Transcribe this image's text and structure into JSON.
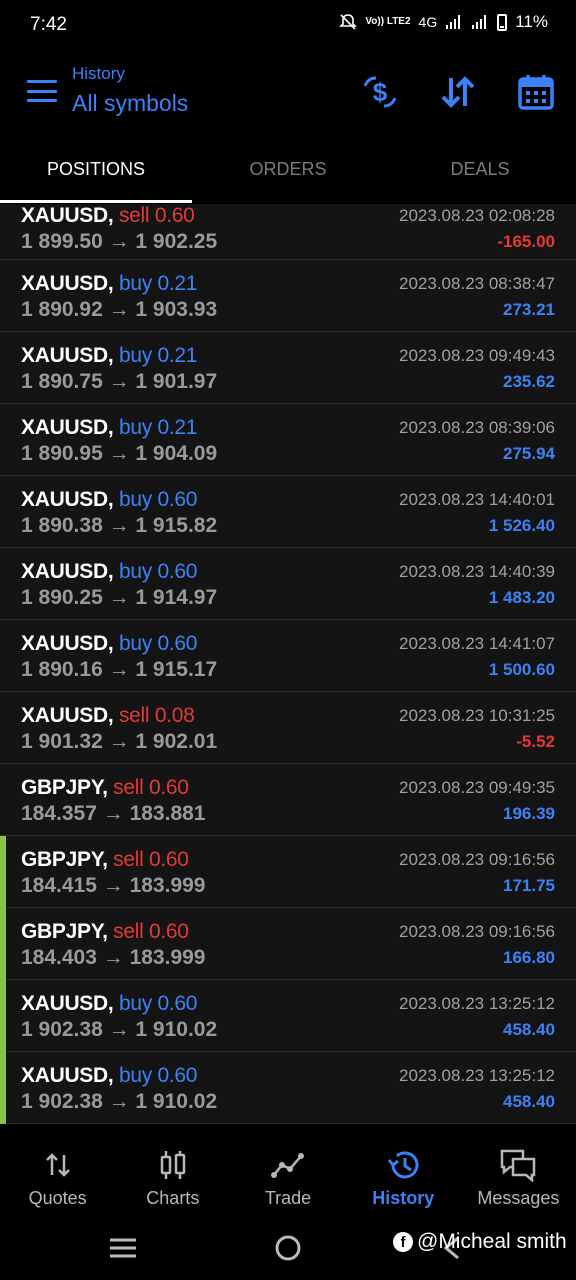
{
  "status": {
    "time": "7:42",
    "network": "4G",
    "volte": "Vo)) LTE2",
    "battery": "11%"
  },
  "header": {
    "title_small": "History",
    "title_large": "All symbols"
  },
  "tabs": [
    "POSITIONS",
    "ORDERS",
    "DEALS"
  ],
  "rows": [
    {
      "symbol": "XAUUSD,",
      "side": "sell 0.60",
      "side_type": "sell",
      "prices": "1 899.50 → 1 902.25",
      "date": "2023.08.23 02:08:28",
      "profit": "-165.00",
      "profit_type": "neg",
      "marked": false
    },
    {
      "symbol": "XAUUSD,",
      "side": "buy 0.21",
      "side_type": "buy",
      "prices": "1 890.92 → 1 903.93",
      "date": "2023.08.23 08:38:47",
      "profit": "273.21",
      "profit_type": "pos",
      "marked": false
    },
    {
      "symbol": "XAUUSD,",
      "side": "buy 0.21",
      "side_type": "buy",
      "prices": "1 890.75 → 1 901.97",
      "date": "2023.08.23 09:49:43",
      "profit": "235.62",
      "profit_type": "pos",
      "marked": false
    },
    {
      "symbol": "XAUUSD,",
      "side": "buy 0.21",
      "side_type": "buy",
      "prices": "1 890.95 → 1 904.09",
      "date": "2023.08.23 08:39:06",
      "profit": "275.94",
      "profit_type": "pos",
      "marked": false
    },
    {
      "symbol": "XAUUSD,",
      "side": "buy 0.60",
      "side_type": "buy",
      "prices": "1 890.38 → 1 915.82",
      "date": "2023.08.23 14:40:01",
      "profit": "1 526.40",
      "profit_type": "pos",
      "marked": false
    },
    {
      "symbol": "XAUUSD,",
      "side": "buy 0.60",
      "side_type": "buy",
      "prices": "1 890.25 → 1 914.97",
      "date": "2023.08.23 14:40:39",
      "profit": "1 483.20",
      "profit_type": "pos",
      "marked": false
    },
    {
      "symbol": "XAUUSD,",
      "side": "buy 0.60",
      "side_type": "buy",
      "prices": "1 890.16 → 1 915.17",
      "date": "2023.08.23 14:41:07",
      "profit": "1 500.60",
      "profit_type": "pos",
      "marked": false
    },
    {
      "symbol": "XAUUSD,",
      "side": "sell 0.08",
      "side_type": "sell",
      "prices": "1 901.32 → 1 902.01",
      "date": "2023.08.23 10:31:25",
      "profit": "-5.52",
      "profit_type": "neg",
      "marked": false
    },
    {
      "symbol": "GBPJPY,",
      "side": "sell 0.60",
      "side_type": "sell",
      "prices": "184.357 → 183.881",
      "date": "2023.08.23 09:49:35",
      "profit": "196.39",
      "profit_type": "pos",
      "marked": false
    },
    {
      "symbol": "GBPJPY,",
      "side": "sell 0.60",
      "side_type": "sell",
      "prices": "184.415 → 183.999",
      "date": "2023.08.23 09:16:56",
      "profit": "171.75",
      "profit_type": "pos",
      "marked": true
    },
    {
      "symbol": "GBPJPY,",
      "side": "sell 0.60",
      "side_type": "sell",
      "prices": "184.403 → 183.999",
      "date": "2023.08.23 09:16:56",
      "profit": "166.80",
      "profit_type": "pos",
      "marked": true
    },
    {
      "symbol": "XAUUSD,",
      "side": "buy 0.60",
      "side_type": "buy",
      "prices": "1 902.38 → 1 910.02",
      "date": "2023.08.23 13:25:12",
      "profit": "458.40",
      "profit_type": "pos",
      "marked": true
    },
    {
      "symbol": "XAUUSD,",
      "side": "buy 0.60",
      "side_type": "buy",
      "prices": "1 902.38 → 1 910.02",
      "date": "2023.08.23 13:25:12",
      "profit": "458.40",
      "profit_type": "pos",
      "marked": true
    }
  ],
  "nav": [
    {
      "label": "Quotes",
      "icon": "quotes-icon"
    },
    {
      "label": "Charts",
      "icon": "charts-icon"
    },
    {
      "label": "Trade",
      "icon": "trade-icon"
    },
    {
      "label": "History",
      "icon": "history-icon"
    },
    {
      "label": "Messages",
      "icon": "messages-icon"
    }
  ],
  "watermark": "@Micheal smith",
  "colors": {
    "accent": "#3b82f6",
    "negative": "#e53935",
    "marker": "#8bc34a"
  }
}
